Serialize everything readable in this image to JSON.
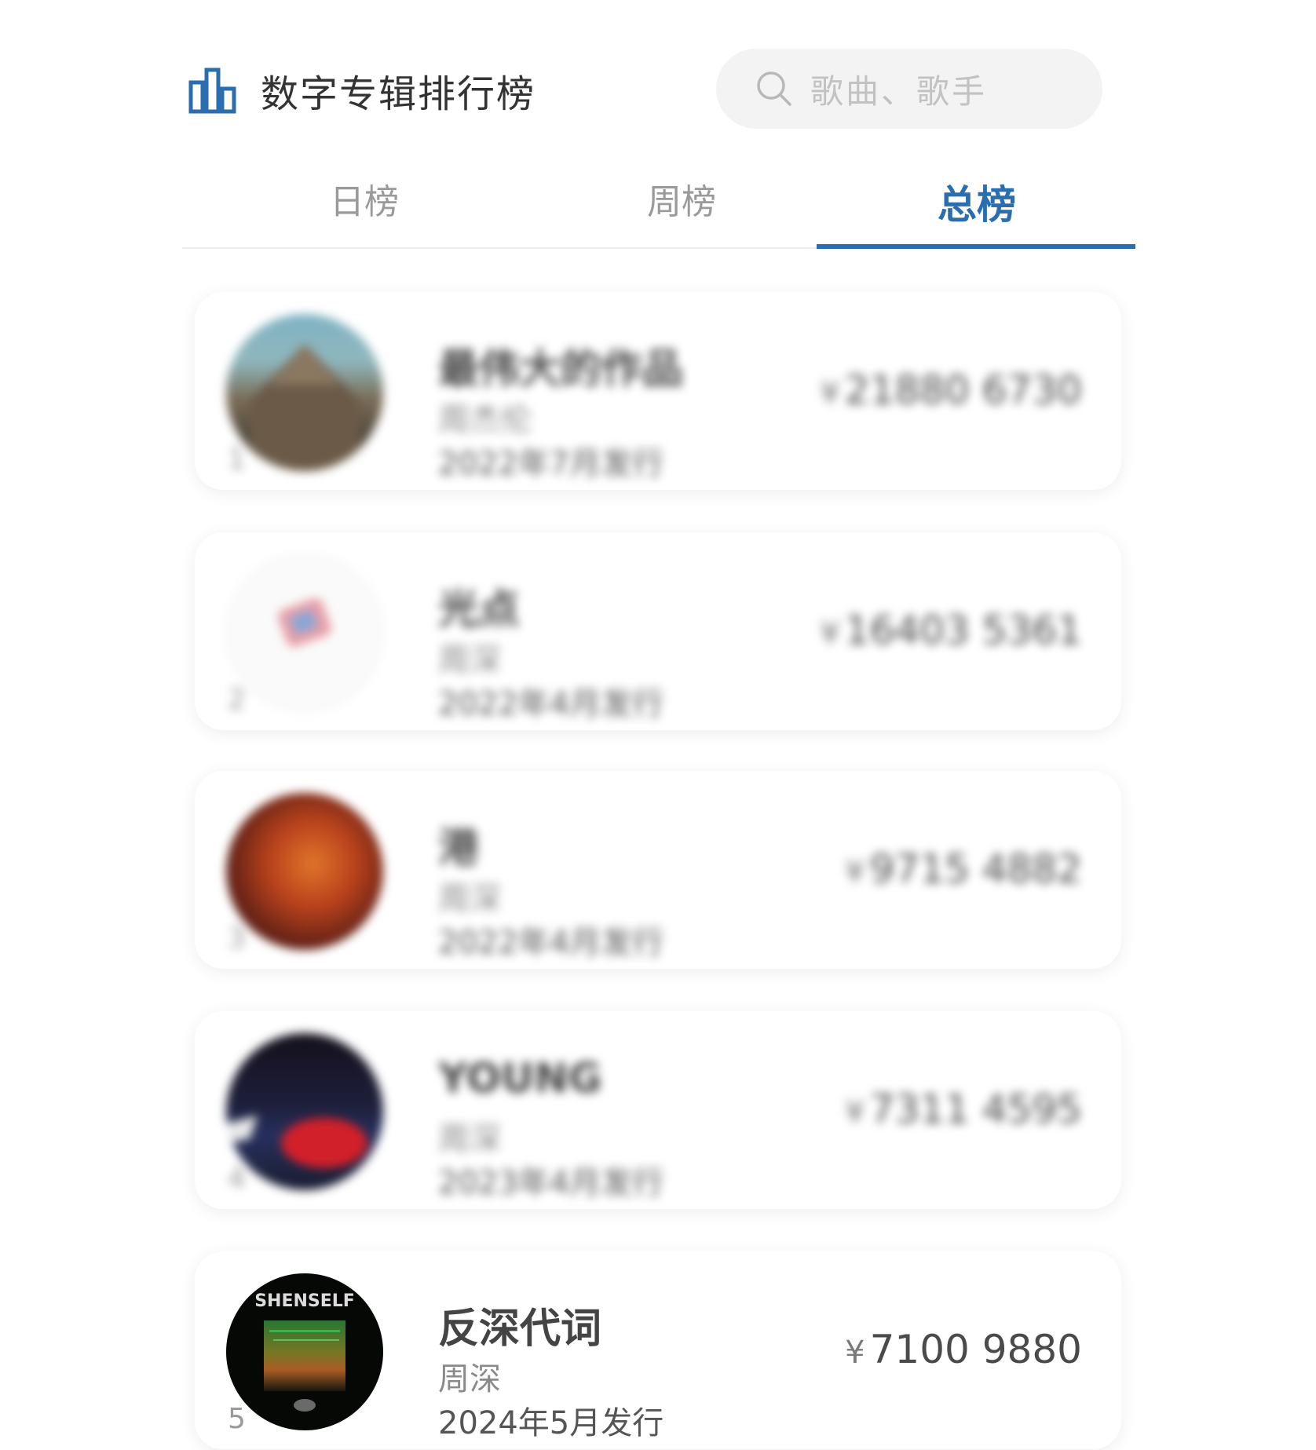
{
  "header": {
    "title": "数字专辑排行榜",
    "icon": "bar-chart-icon",
    "search_placeholder": "歌曲、歌手"
  },
  "tabs": [
    {
      "label": "日榜",
      "active": false
    },
    {
      "label": "周榜",
      "active": false
    },
    {
      "label": "总榜",
      "active": true
    }
  ],
  "colors": {
    "accent": "#2a6eb0"
  },
  "albums": [
    {
      "rank": "1",
      "name": "最伟大的作品",
      "artist": "周杰伦",
      "release": "2022年7月发行",
      "price": "21880 6730",
      "currency": "¥",
      "blurred": true
    },
    {
      "rank": "2",
      "name": "光点",
      "artist": "周深",
      "release": "2022年4月发行",
      "price": "16403 5361",
      "currency": "¥",
      "blurred": true
    },
    {
      "rank": "3",
      "name": "港",
      "artist": "周深",
      "release": "2022年4月发行",
      "price": "9715 4882",
      "currency": "¥",
      "blurred": true
    },
    {
      "rank": "4",
      "name": "YOUNG",
      "artist": "周深",
      "release": "2023年4月发行",
      "price": "7311 4595",
      "currency": "¥",
      "blurred": true
    },
    {
      "rank": "5",
      "name": "反深代词",
      "artist": "周深",
      "release": "2024年5月发行",
      "price": "7100 9880",
      "currency": "¥",
      "blurred": false,
      "cover_text": "SHENSELF"
    }
  ]
}
